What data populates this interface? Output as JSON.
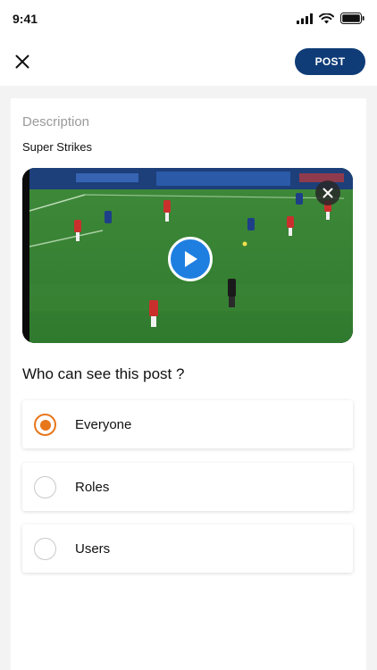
{
  "status_bar": {
    "time": "9:41"
  },
  "header": {
    "post_label": "POST"
  },
  "form": {
    "description_label": "Description",
    "description_value": "Super Strikes"
  },
  "visibility": {
    "question": "Who can see this post ?",
    "options": [
      {
        "label": "Everyone",
        "selected": true
      },
      {
        "label": "Roles",
        "selected": false
      },
      {
        "label": "Users",
        "selected": false
      }
    ]
  },
  "colors": {
    "accent": "#e8761a",
    "primary": "#0f3c77",
    "play": "#1f7fe0"
  },
  "icons": {
    "close": "close-icon",
    "play": "play-icon",
    "remove_video": "remove-video-icon",
    "signal": "signal-icon",
    "wifi": "wifi-icon",
    "battery": "battery-icon"
  }
}
